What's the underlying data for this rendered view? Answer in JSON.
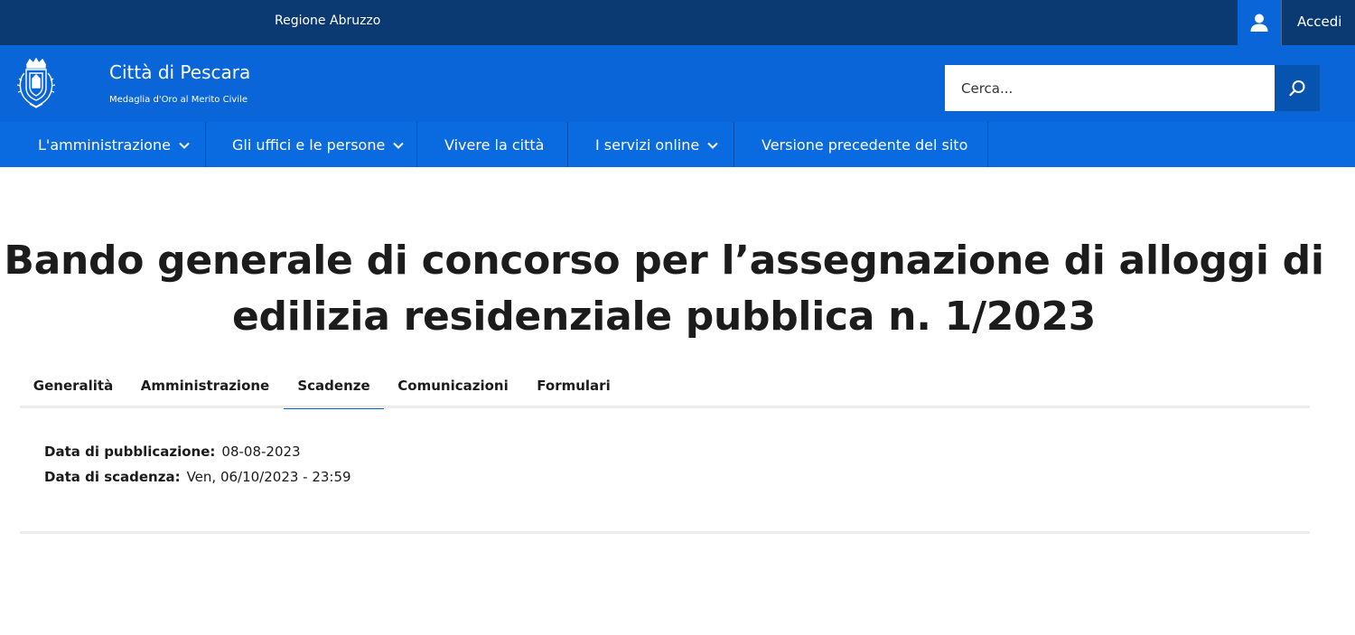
{
  "topbar": {
    "region": "Regione Abruzzo",
    "login": "Accedi",
    "user_icon": "user-icon"
  },
  "header": {
    "title": "Città di Pescara",
    "subtitle": "Medaglia d'Oro al Merito Civile",
    "logo_icon": "coat-of-arms-icon"
  },
  "search": {
    "placeholder": "Cerca...",
    "icon": "search-icon"
  },
  "nav": {
    "items": [
      {
        "label": "L'amministrazione",
        "has_dropdown": true
      },
      {
        "label": "Gli uffici e le persone",
        "has_dropdown": true
      },
      {
        "label": "Vivere la città",
        "has_dropdown": false
      },
      {
        "label": "I servizi online",
        "has_dropdown": true
      },
      {
        "label": "Versione precedente del sito",
        "has_dropdown": false
      }
    ]
  },
  "page": {
    "title": "Bando generale di concorso per l’assegnazione di alloggi di edilizia residenziale pubblica n. 1/2023"
  },
  "tabs": {
    "items": [
      {
        "label": "Generalità"
      },
      {
        "label": "Amministrazione"
      },
      {
        "label": "Scadenze"
      },
      {
        "label": "Comunicazioni"
      },
      {
        "label": "Formulari"
      }
    ],
    "active": "Scadenze"
  },
  "details": {
    "publication_label": "Data di pubblicazione:",
    "publication_value": "08-08-2023",
    "deadline_label": "Data di scadenza:",
    "deadline_value": "Ven, 06/10/2023 - 23:59"
  },
  "colors": {
    "topbar": "#0b3a73",
    "header": "#0a66d8",
    "nav": "#0a6ae0",
    "accent": "#0a66d8"
  }
}
